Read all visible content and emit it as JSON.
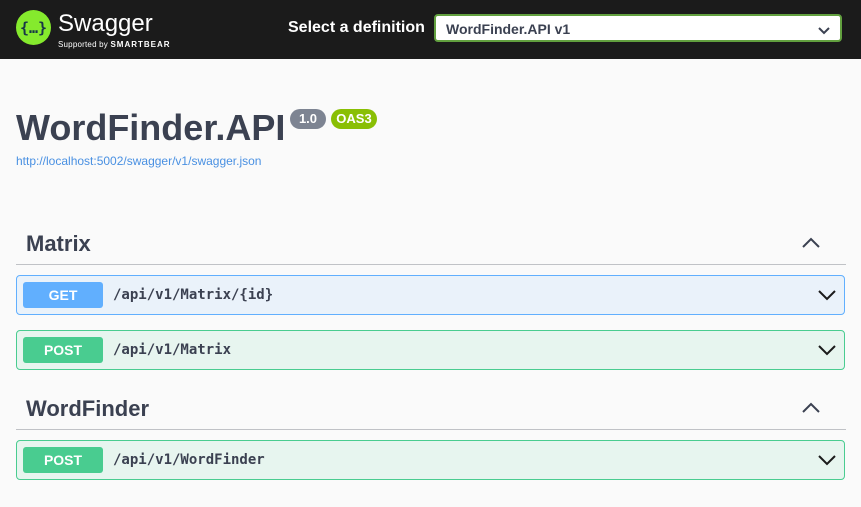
{
  "topbar": {
    "brand": "Swagger",
    "brand_sub_prefix": "Supported by",
    "brand_sub_company": "SMARTBEAR",
    "definition_label": "Select a definition",
    "definition_selected": "WordFinder.API v1"
  },
  "info": {
    "title": "WordFinder.API",
    "version": "1.0",
    "oas_badge": "OAS3",
    "spec_url": "http://localhost:5002/swagger/v1/swagger.json"
  },
  "tags": [
    {
      "name": "Matrix",
      "operations": [
        {
          "method": "GET",
          "path": "/api/v1/Matrix/{id}"
        },
        {
          "method": "POST",
          "path": "/api/v1/Matrix"
        }
      ]
    },
    {
      "name": "WordFinder",
      "operations": [
        {
          "method": "POST",
          "path": "/api/v1/WordFinder"
        }
      ]
    }
  ],
  "colors": {
    "topbar_bg": "#1b1b1b",
    "brand_green": "#85ea2d",
    "get": "#61affe",
    "post": "#49cc90",
    "select_border": "#62a03f",
    "version_badge": "#7d8492",
    "oas_badge": "#89bf04",
    "link": "#4990e2"
  },
  "icons": {
    "logo": "swagger-braces-icon",
    "select_arrow": "chevron-down-icon",
    "tag_toggle": "chevron-up-icon",
    "op_expand": "chevron-down-icon"
  }
}
